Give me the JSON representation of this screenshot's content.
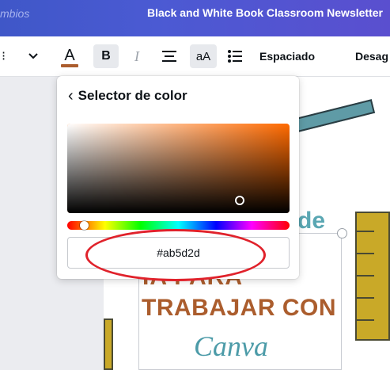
{
  "header": {
    "left_text": "mbios",
    "title": "Black and White Book Classroom Newsletter"
  },
  "toolbar": {
    "more": "⁝",
    "chevron": "⌄",
    "text_color_glyph": "A",
    "text_color": "#ab5d2d",
    "bold": "B",
    "italic": "I",
    "align": "☰",
    "case": "aA",
    "list": "☷",
    "spacing": "Espaciado",
    "desag": "Desag"
  },
  "picker": {
    "back_icon": "‹",
    "title": "Selector de color",
    "hex_value": "#ab5d2d"
  },
  "canvas": {
    "de": "de",
    "line1": "IA PARA",
    "line2": "TRABAJAR CON",
    "logo": "Canva"
  }
}
